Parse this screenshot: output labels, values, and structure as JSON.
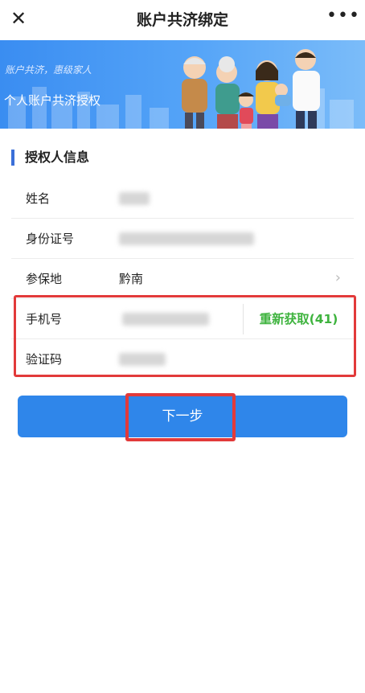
{
  "header": {
    "close_icon": "✕",
    "title": "账户共济绑定",
    "more_icon": "•••"
  },
  "banner": {
    "slogan": "账户共济，惠级家人",
    "title": "个人账户共济授权"
  },
  "section": {
    "title": "授权人信息"
  },
  "form": {
    "name_label": "姓名",
    "id_label": "身份证号",
    "region_label": "参保地",
    "region_value": "黔南",
    "phone_label": "手机号",
    "resend_label": "重新获取(41)",
    "code_label": "验证码"
  },
  "next": {
    "label": "下一步"
  },
  "colors": {
    "primary": "#2f86ea",
    "highlight": "#e23a3a",
    "success": "#3eb33e",
    "section_bar": "#3b6fd8"
  }
}
